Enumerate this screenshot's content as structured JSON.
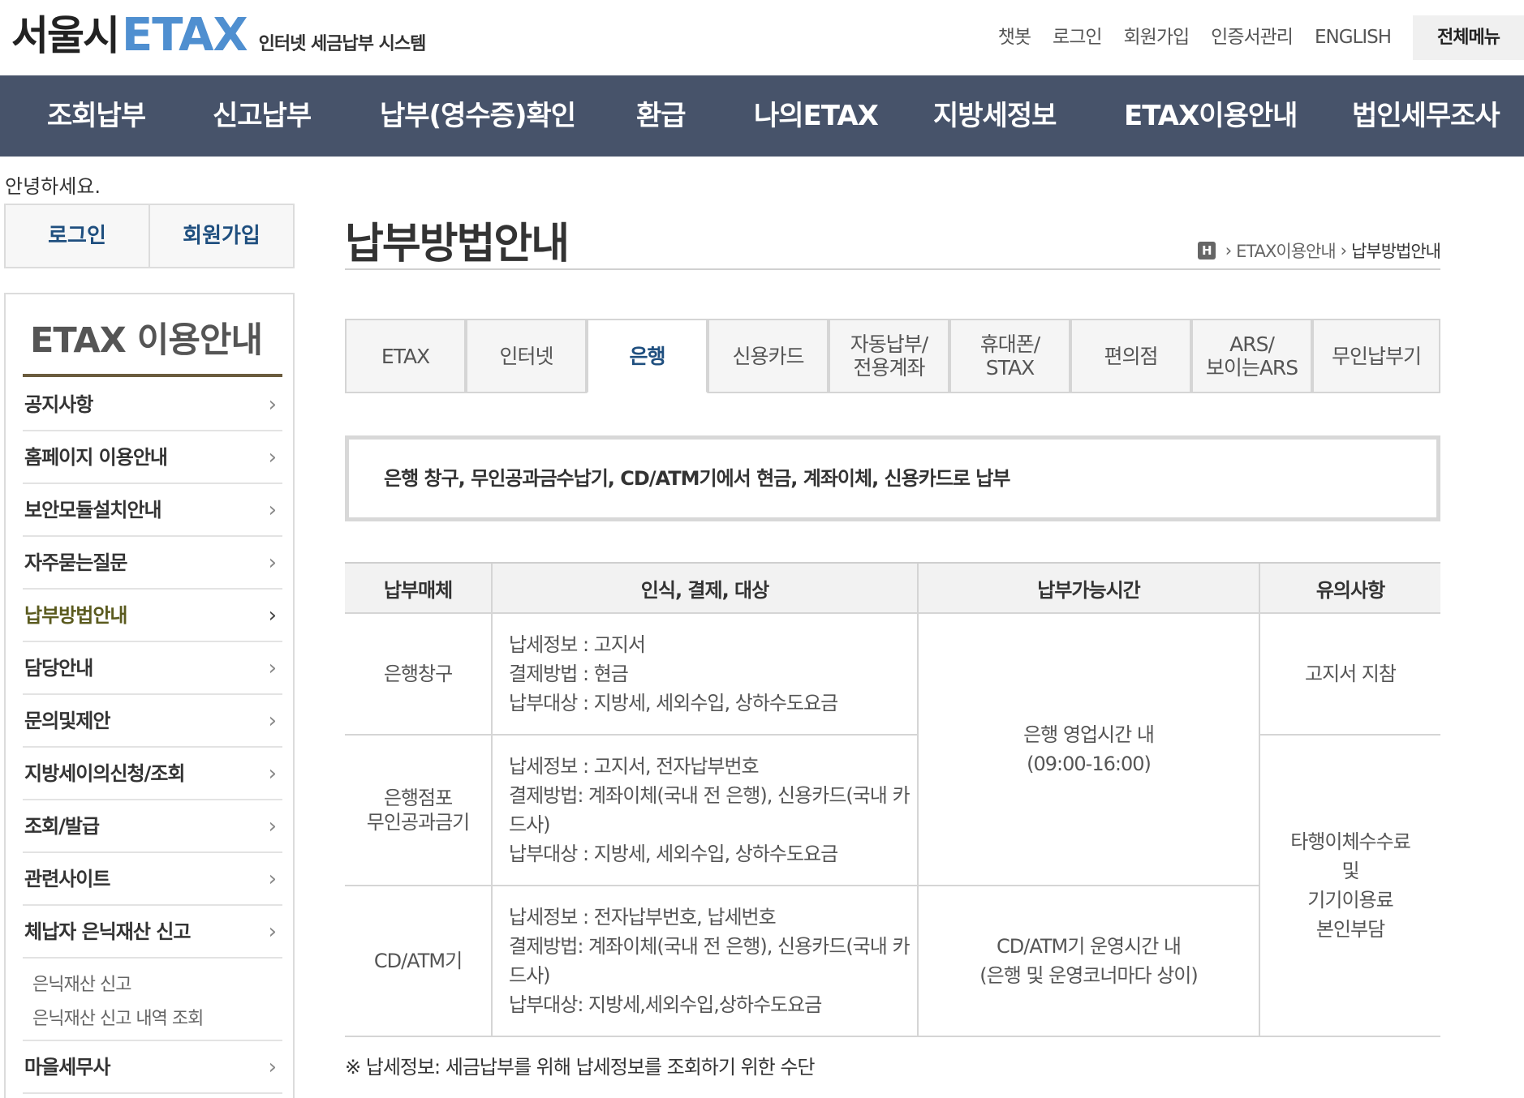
{
  "header": {
    "logo_seoul": "서울시",
    "logo_etax": "ETAX",
    "logo_sub": "인터넷 세금납부 시스템",
    "util_links": [
      "챗봇",
      "로그인",
      "회원가입",
      "인증서관리",
      "ENGLISH"
    ],
    "all_menu": "전체메뉴"
  },
  "gnb": [
    "조회납부",
    "신고납부",
    "납부(영수증)확인",
    "환급",
    "나의ETAX",
    "지방세정보",
    "ETAX이용안내",
    "법인세무조사"
  ],
  "left": {
    "greeting": "안녕하세요.",
    "login": "로그인",
    "signup": "회원가입",
    "lnb_title": "ETAX 이용안내",
    "items": [
      {
        "label": "공지사항"
      },
      {
        "label": "홈페이지 이용안내"
      },
      {
        "label": "보안모듈설치안내"
      },
      {
        "label": "자주묻는질문"
      },
      {
        "label": "납부방법안내"
      },
      {
        "label": "담당안내"
      },
      {
        "label": "문의및제안"
      },
      {
        "label": "지방세이의신청/조회"
      },
      {
        "label": "조회/발급"
      },
      {
        "label": "관련사이트"
      },
      {
        "label": "체납자 은닉재산 신고"
      }
    ],
    "sub_items": [
      "은닉재산 신고",
      "은닉재산 신고 내역 조회"
    ],
    "last_item": "마을세무사",
    "active_item": "납부방법안내"
  },
  "main": {
    "title": "납부방법안내",
    "breadcrumb": {
      "home": "H",
      "level1": "ETAX이용안내",
      "level2": "납부방법안내"
    },
    "tabs": [
      "ETAX",
      "인터넷",
      "은행",
      "신용카드",
      "자동납부/\n전용계좌",
      "휴대폰/\nSTAX",
      "편의점",
      "ARS/\n보이는ARS",
      "무인납부기"
    ],
    "active_tab": "은행",
    "info": "은행 창구, 무인공과금수납기, CD/ATM기에서 현금, 계좌이체, 신용카드로 납부",
    "table": {
      "headers": [
        "납부매체",
        "인식, 결제, 대상",
        "납부가능시간",
        "유의사항"
      ],
      "rows": [
        {
          "media": [
            "은행창구"
          ],
          "details": [
            "납세정보 : 고지서",
            "결제방법 : 현금",
            "납부대상 : 지방세, 세외수입, 상하수도요금"
          ]
        },
        {
          "media": [
            "은행점포",
            "무인공과금기"
          ],
          "details": [
            "납세정보 : 고지서, 전자납부번호",
            "결제방법: 계좌이체(국내 전 은행), 신용카드(국내 카드사)",
            "납부대상 : 지방세, 세외수입, 상하수도요금"
          ]
        },
        {
          "media": [
            "CD/ATM기"
          ],
          "details": [
            "납세정보 : 전자납부번호, 납세번호",
            "결제방법: 계좌이체(국내 전 은행), 신용카드(국내 카드사)",
            "납부대상: 지방세,세외수입,상하수도요금"
          ]
        }
      ],
      "time_bank": [
        "은행 영업시간 내",
        "(09:00-16:00)"
      ],
      "time_atm": [
        "CD/ATM기 운영시간 내",
        "(은행 및 운영코너마다 상이)"
      ],
      "note_1": "고지서 지참",
      "note_2": [
        "타행이체수수료",
        "및",
        "기기이용료",
        "본인부담"
      ]
    },
    "footnote": "※ 납세정보: 세금납부를 위해 납세정보를 조회하기 위한 수단"
  },
  "colors": {
    "gnb_bg": "#47536a",
    "etax_blue": "#4f8fd0",
    "lnb_accent": "#6b5c3e",
    "link_blue": "#1f4f7f"
  }
}
